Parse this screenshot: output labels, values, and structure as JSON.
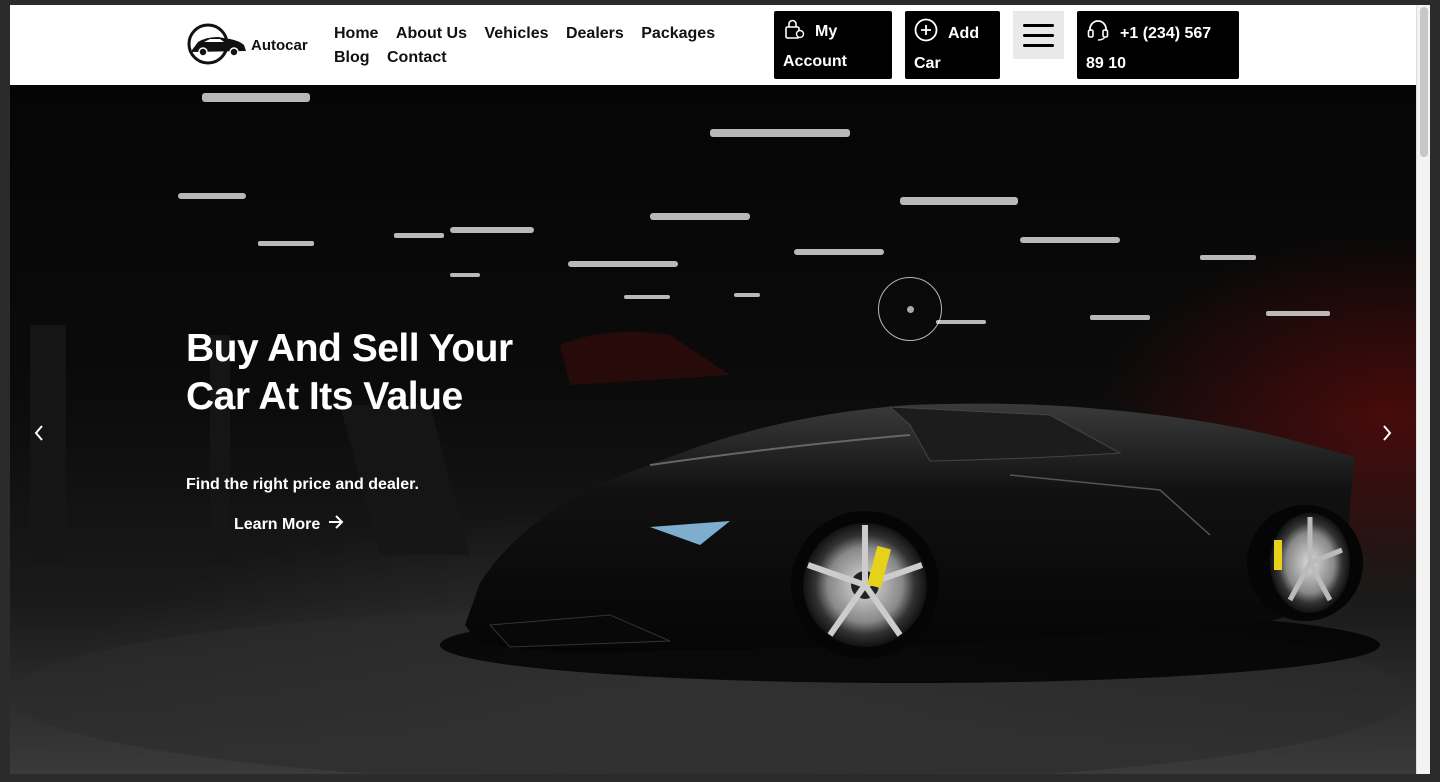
{
  "brand": {
    "name": "Autocar",
    "logo_icon": "car-logo"
  },
  "nav": [
    {
      "label": "Home"
    },
    {
      "label": "About Us"
    },
    {
      "label": "Vehicles"
    },
    {
      "label": "Dealers"
    },
    {
      "label": "Packages"
    },
    {
      "label": "Blog"
    },
    {
      "label": "Contact"
    }
  ],
  "actions": {
    "account": {
      "label": "My Account",
      "icon": "lock-icon"
    },
    "add_car": {
      "label": "Add Car",
      "icon": "plus-circle-icon"
    },
    "menu": {
      "icon": "hamburger-menu-icon"
    },
    "phone": {
      "label": "+1 (234) 567 89 10",
      "icon": "headset-icon"
    }
  },
  "hero": {
    "title": "Buy And Sell Your Car At Its Value",
    "subtitle": "Find the right price and dealer.",
    "cta": "Learn More",
    "prev_icon": "chevron-left-icon",
    "next_icon": "chevron-right-icon"
  },
  "colors": {
    "header_bg": "#ffffff",
    "button_bg": "#000000",
    "text_dark": "#111111",
    "hero_accent": "#7a0a0a"
  }
}
